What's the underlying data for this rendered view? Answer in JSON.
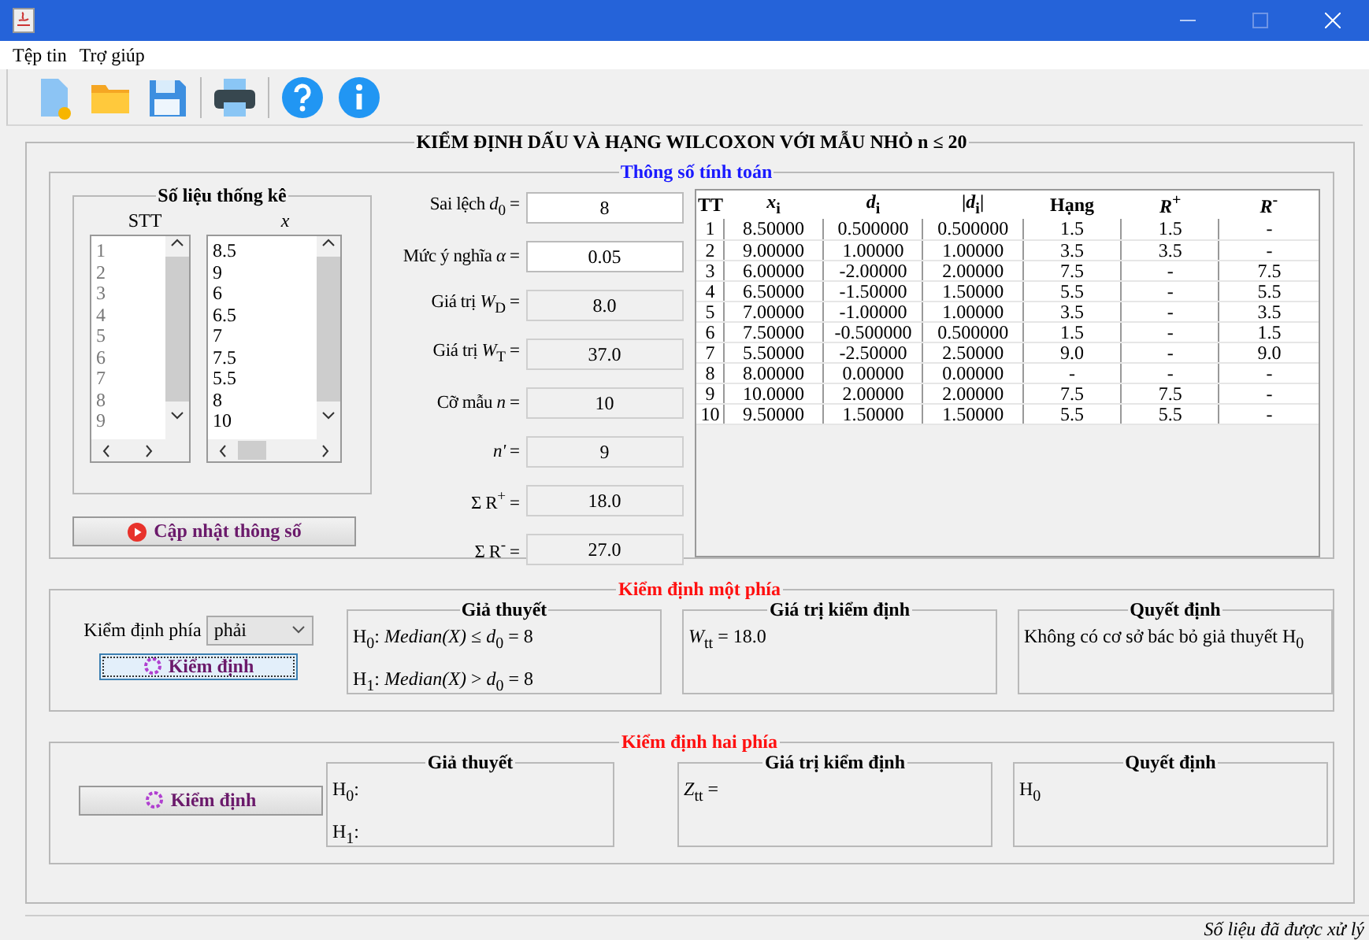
{
  "menu": [
    "Tệp tin",
    "Trợ giúp"
  ],
  "title": "KIỂM ĐỊNH DẤU VÀ HẠNG WILCOXON VỚI MẪU NHỎ n ≤ 20",
  "parameters": {
    "title": "Thông số tính toán",
    "data_panel": {
      "title": "Số liệu thống kê",
      "index_header": "STT",
      "value_header": "x",
      "indices": [
        "1",
        "2",
        "3",
        "4",
        "5",
        "6",
        "7",
        "8",
        "9"
      ],
      "values": [
        "8.5",
        "9",
        "6",
        "6.5",
        "7",
        "7.5",
        "5.5",
        "8",
        "10"
      ]
    },
    "update_button": "Cập nhật thông số",
    "fields": [
      {
        "label": "Sai lệch *d*$_{0}$ =",
        "value": "8",
        "editable": true
      },
      {
        "label": "Mức ý nghĩa *α* =",
        "value": "0.05",
        "editable": true
      },
      {
        "label": "Giá trị *W*$_{D}$ =",
        "value": "8.0",
        "editable": false
      },
      {
        "label": "Giá trị *W*$_{T}$ =",
        "value": "37.0",
        "editable": false
      },
      {
        "label": "Cỡ mẫu *n* =",
        "value": "10",
        "editable": false
      },
      {
        "label": "*n'* =",
        "value": "9",
        "editable": false
      },
      {
        "label": "Σ R$^{+}$ =",
        "value": "18.0",
        "editable": false
      },
      {
        "label": "Σ R$^{-}$ =",
        "value": "27.0",
        "editable": false
      }
    ],
    "table": {
      "columns": [
        "TT",
        "*x*$_{i}$",
        "*d*$_{i}$",
        "|*d*$_{i}$|",
        "Hạng",
        "*R*$^{+}$",
        "*R*$^{-}$"
      ],
      "rows": [
        [
          "1",
          "8.50000",
          "0.500000",
          "0.500000",
          "1.5",
          "1.5",
          "-"
        ],
        [
          "2",
          "9.00000",
          "1.00000",
          "1.00000",
          "3.5",
          "3.5",
          "-"
        ],
        [
          "3",
          "6.00000",
          "-2.00000",
          "2.00000",
          "7.5",
          "-",
          "7.5"
        ],
        [
          "4",
          "6.50000",
          "-1.50000",
          "1.50000",
          "5.5",
          "-",
          "5.5"
        ],
        [
          "5",
          "7.00000",
          "-1.00000",
          "1.00000",
          "3.5",
          "-",
          "3.5"
        ],
        [
          "6",
          "7.50000",
          "-0.500000",
          "0.500000",
          "1.5",
          "-",
          "1.5"
        ],
        [
          "7",
          "5.50000",
          "-2.50000",
          "2.50000",
          "9.0",
          "-",
          "9.0"
        ],
        [
          "8",
          "8.00000",
          "0.00000",
          "0.00000",
          "-",
          "-",
          "-"
        ],
        [
          "9",
          "10.0000",
          "2.00000",
          "2.00000",
          "7.5",
          "7.5",
          "-"
        ],
        [
          "10",
          "9.50000",
          "1.50000",
          "1.50000",
          "5.5",
          "5.5",
          "-"
        ]
      ]
    }
  },
  "tests": [
    {
      "kind": "one_sided",
      "title": "Kiểm định một phía",
      "side_label": "Kiểm định phía",
      "side_value": "phải",
      "button": "Kiểm định",
      "focused": true,
      "hypothesis": {
        "title": "Giả thuyết",
        "lines": [
          "H$_{0}$: *Median(X)* ≤ *d*$_{0}$ = 8",
          "H$_{1}$: *Median(X)* > *d*$_{0}$ = 8"
        ]
      },
      "statistic": {
        "title": "Giá trị kiểm định",
        "text": "*W*$_{tt}$ = 18.0"
      },
      "decision": {
        "title": "Quyết định",
        "text": "Không có cơ sở bác bỏ giả thuyết H$_{0}$"
      }
    },
    {
      "kind": "two_sided",
      "title": "Kiểm định hai phía",
      "button": "Kiểm định",
      "focused": false,
      "hypothesis": {
        "title": "Giả thuyết",
        "lines": [
          "H$_{0}$:",
          "H$_{1}$:"
        ]
      },
      "statistic": {
        "title": "Giá trị kiểm định",
        "text": "*Z*$_{tt}$ ="
      },
      "decision": {
        "title": "Quyết định",
        "text": "H$_{0}$"
      }
    }
  ],
  "status_bar": "Số liệu đã được xử lý"
}
